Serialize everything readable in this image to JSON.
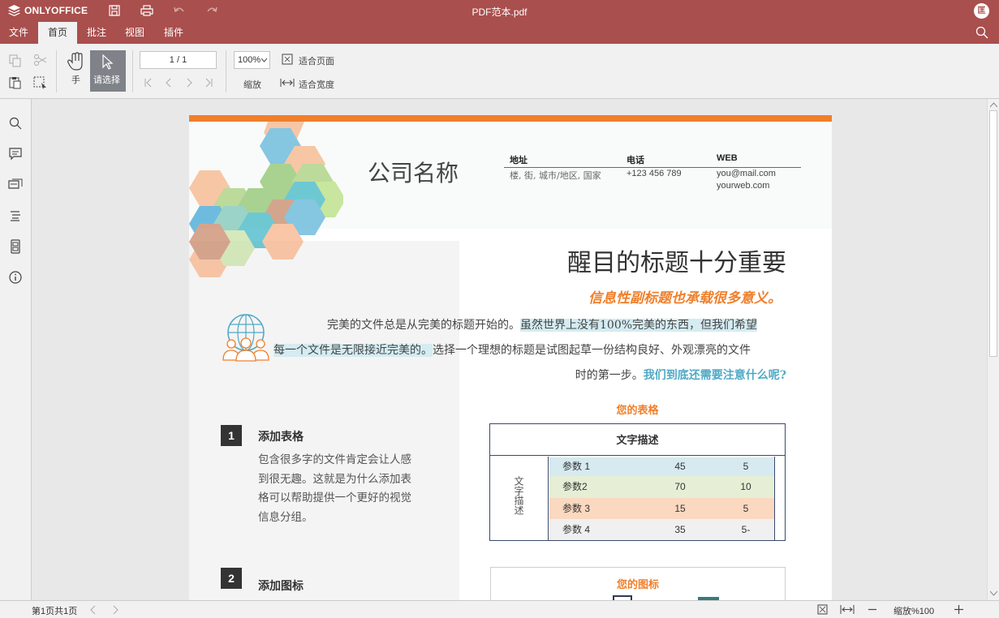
{
  "app": {
    "brand": "ONLYOFFICE",
    "doc_title": "PDF范本.pdf",
    "user_initial": "匡"
  },
  "menu": {
    "tabs": [
      "文件",
      "首页",
      "批注",
      "视图",
      "插件"
    ],
    "active": "首页"
  },
  "toolbar": {
    "hand_label": "手",
    "select_label": "请选择",
    "page_value": "1 / 1",
    "zoom_value": "100%",
    "zoom_label": "缩放",
    "fit_page_label": "适合页面",
    "fit_width_label": "适合宽度"
  },
  "status": {
    "page_info": "第1页共1页",
    "zoom_text": "缩放%100"
  },
  "document": {
    "company_name": "公司名称",
    "contact": {
      "address_label": "地址",
      "address_value": "楼, 街, 城市/地区, 国家",
      "phone_label": "电话",
      "phone_value": "+123 456 789",
      "web_label": "WEB",
      "web_email": "you@mail.com",
      "web_url": "yourweb.com"
    },
    "headline": "醒目的标题十分重要",
    "subhead": "信息性副标题也承载很多意义。",
    "body_p1": "完美的文件总是从完美的标题开始的。",
    "body_hl1": "虽然世界上没有100%完美的东西，但我们希望",
    "body_hl2": "每一个文件是无限接近完美的。",
    "body_p2": "选择一个理想的标题是试图起草一份结构良好、外观漂亮的文件",
    "body_p3": "时的第一步。",
    "body_question": "我们到底还需要注意什么呢?",
    "section1": {
      "num": "1",
      "title": "添加表格",
      "lines": [
        "包含很多字的文件肯定会让人感",
        "到很无趣。这就是为什么添加表",
        "格可以帮助提供一个更好的视觉",
        "信息分组。"
      ]
    },
    "section2": {
      "num": "2",
      "title": "添加图标"
    },
    "table": {
      "caption": "您的表格",
      "header": "文字描述",
      "side_label": "文字描述",
      "rows": [
        {
          "label": "参数 1",
          "a": "45",
          "b": "5",
          "color": "#d6eaf0"
        },
        {
          "label": "参数2",
          "a": "70",
          "b": "10",
          "color": "#e6efd6"
        },
        {
          "label": "参数 3",
          "a": "15",
          "b": "5",
          "color": "#fbd8c0"
        },
        {
          "label": "参数 4",
          "a": "35",
          "b": "5-",
          "color": "#f0f0f0"
        }
      ]
    },
    "icon_box_title": "您的图标",
    "colors": {
      "accent_orange": "#f07f2a",
      "accent_blue": "#4fa9c6",
      "brand_red": "#a94f4d"
    }
  }
}
